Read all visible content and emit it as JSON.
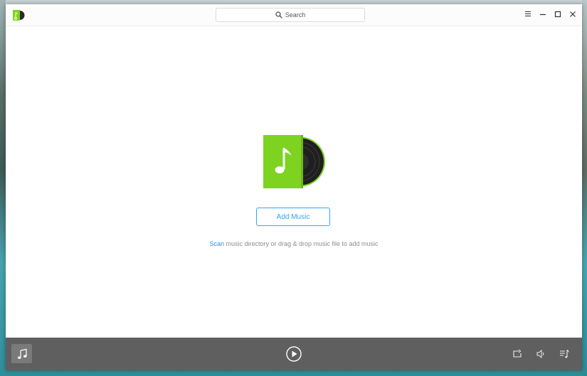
{
  "titlebar": {
    "search_label": "Search",
    "icons": [
      "app-logo-icon",
      "search-icon",
      "menu-icon",
      "minimize-icon",
      "maximize-icon",
      "close-icon"
    ]
  },
  "main": {
    "add_music_label": "Add Music",
    "hint_scan": "Scan",
    "hint_rest": " music directory or drag & drop music file to add music"
  },
  "player": {
    "icons": [
      "music-note-icon",
      "play-icon",
      "repeat-icon",
      "volume-icon",
      "playlist-icon"
    ]
  },
  "colors": {
    "accent": "#2ca7f8",
    "brand_green": "#7ed321",
    "player_bg": "#5f5f5f"
  }
}
